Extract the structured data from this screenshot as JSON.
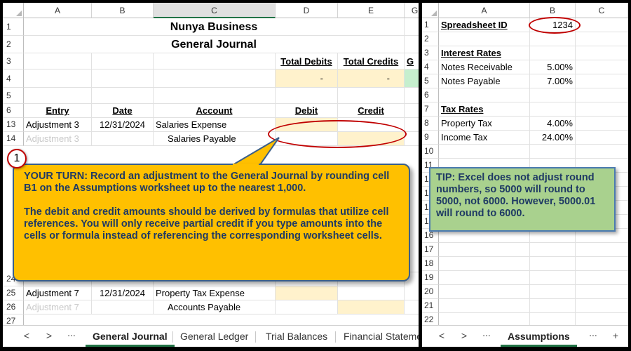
{
  "left": {
    "columns": [
      "A",
      "B",
      "C",
      "D",
      "E",
      "G"
    ],
    "rows": {
      "r1": "1",
      "r2": "2",
      "r3": "3",
      "r4": "4",
      "r5": "5",
      "r6": "6",
      "r13": "13",
      "r14": "14",
      "r24": "24",
      "r25": "25",
      "r26": "26",
      "r27": "27"
    },
    "company": "Nunya Business",
    "journal_title": "General Journal",
    "total_debits_label": "Total Debits",
    "total_credits_label": "Total Credits",
    "g_partial": "G",
    "total_debits_value": "-",
    "total_credits_value": "-",
    "headers": {
      "entry": "Entry",
      "date": "Date",
      "account": "Account",
      "debit": "Debit",
      "credit": "Credit"
    },
    "row13": {
      "entry": "Adjustment 3",
      "date": "12/31/2024",
      "account": "Salaries Expense"
    },
    "row14": {
      "entry": "Adjustment 3",
      "account": "Salaries Payable"
    },
    "row25": {
      "entry": "Adjustment 7",
      "date": "12/31/2024",
      "account": "Property Tax Expense"
    },
    "row26": {
      "entry": "Adjustment 7",
      "account": "Accounts Payable"
    },
    "tabs": {
      "prev": "<",
      "next": ">",
      "more": "...",
      "general_journal": "General Journal",
      "general_ledger": "General Ledger",
      "trial_balances": "Trial Balances",
      "financial_statements": "Financial Stateme"
    }
  },
  "callout": {
    "step_number": "1",
    "paragraph1": "YOUR TURN: Record an adjustment to the General Journal by rounding cell B1 on the Assumptions worksheet up to the nearest 1,000.",
    "paragraph2": "The debit and credit amounts should be derived by formulas that utilize cell references. You will only receive partial credit if you type amounts into the cells or formula instead of referencing the corresponding worksheet cells."
  },
  "right": {
    "columns": [
      "A",
      "B",
      "C"
    ],
    "rows": [
      "1",
      "2",
      "3",
      "4",
      "5",
      "6",
      "7",
      "8",
      "9",
      "10",
      "11",
      "12",
      "13",
      "14",
      "15",
      "16",
      "17",
      "18",
      "19",
      "20",
      "21",
      "22"
    ],
    "spreadsheet_id_label": "Spreadsheet ID",
    "spreadsheet_id_value": "1234",
    "interest_rates_label": "Interest Rates",
    "notes_receivable_label": "Notes Receivable",
    "notes_receivable_value": "5.00%",
    "notes_payable_label": "Notes Payable",
    "notes_payable_value": "7.00%",
    "tax_rates_label": "Tax Rates",
    "property_tax_label": "Property Tax",
    "property_tax_value": "4.00%",
    "income_tax_label": "Income Tax",
    "income_tax_value": "24.00%",
    "tip": "TIP: Excel does not adjust round numbers, so 5000 will round to 5000, not 6000. However, 5000.01 will round to 6000.",
    "tabs": {
      "prev": "<",
      "next": ">",
      "more": "...",
      "assumptions": "Assumptions",
      "more2": "...",
      "add": "+"
    }
  },
  "colors": {
    "accent_green": "#217346",
    "input_yellow": "#fff2cc",
    "total_green": "#c6efce",
    "callout_orange": "#ffc000",
    "tip_green": "#a9d18e",
    "highlight_red": "#c00000"
  }
}
